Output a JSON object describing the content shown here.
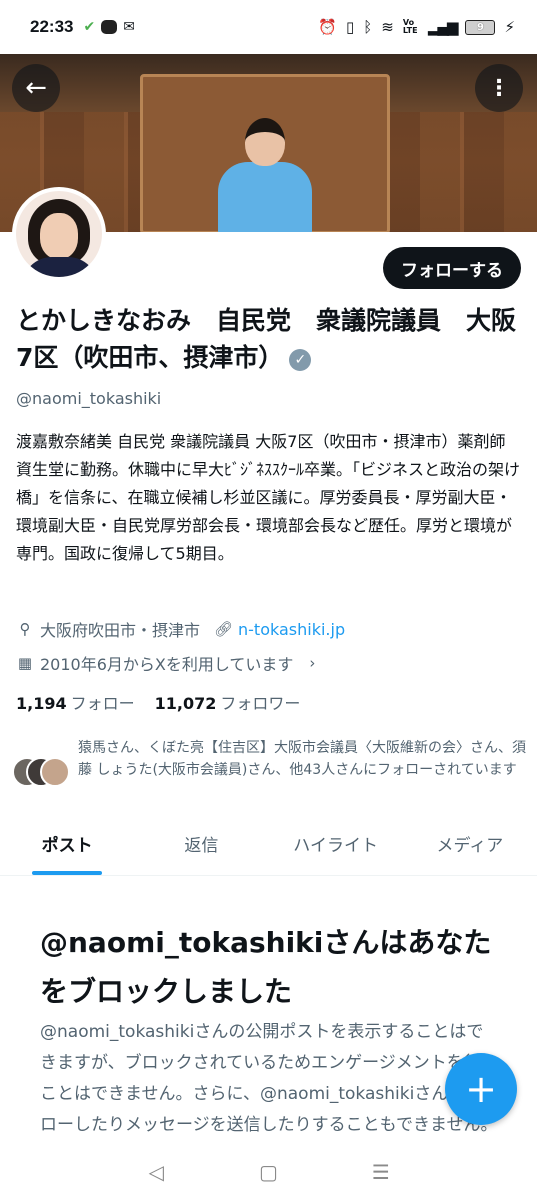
{
  "status_bar": {
    "time": "22:33",
    "left_icons": [
      "check-icon",
      "line-icon",
      "mail-icon"
    ],
    "right_icons": [
      "alarm-icon",
      "vibrate-icon",
      "bluetooth-icon",
      "wifi-icon",
      "volte-icon",
      "signal-icon",
      "battery-icon",
      "charging-icon"
    ],
    "battery_level": "9",
    "volte": "Vo LTE"
  },
  "profile": {
    "name": "とかしきなおみ　自民党　衆議院議員　大阪7区（吹田市、摂津市）",
    "handle": "@naomi_tokashiki",
    "follow_button": "フォローする",
    "bio": "渡嘉敷奈緒美 自民党 衆議院議員 大阪7区（吹田市・摂津市）薬剤師 資生堂に勤務。休職中に早大ﾋﾞｼﾞﾈｽｽｸｰﾙ卒業。「ビジネスと政治の架け橋」を信条に、在職立候補し杉並区議に。厚労委員長・厚労副大臣・環境副大臣・自民党厚労部会長・環境部会長など歴任。厚労と環境が専門。国政に復帰して5期目。",
    "location": "大阪府吹田市・摂津市",
    "website": "n-tokashiki.jp",
    "joined": "2010年6月からXを利用しています",
    "following_count": "1,194",
    "following_label": "フォロー",
    "followers_count": "11,072",
    "followers_label": "フォロワー",
    "followers_you_know": "猿馬さん、くぼた亮【住吉区】大阪市会議員〈大阪維新の会〉さん、須藤 しょうた(大阪市会議員)さん、他43人さんにフォローされています"
  },
  "tabs": [
    {
      "label": "ポスト",
      "active": true
    },
    {
      "label": "返信",
      "active": false
    },
    {
      "label": "ハイライト",
      "active": false
    },
    {
      "label": "メディア",
      "active": false
    }
  ],
  "blocked": {
    "title": "@naomi_tokashikiさんはあなたをブロックしました",
    "body": "@naomi_tokashikiさんの公開ポストを表示することはできますが、ブロックされているためエンゲージメントを行うことはできません。さらに、@naomi_tokashikiさんをフォローしたりメッセージを送信したりすることもできません。",
    "trailing": "_tokashikiさんをフォローしたりメッセージを送信"
  },
  "fab_icon": "plus-icon",
  "nav": {
    "back": "◁",
    "home": "▢",
    "menu": "☰"
  },
  "colors": {
    "accent": "#1d9bf0",
    "text": "#0f1419",
    "secondary": "#536471"
  }
}
